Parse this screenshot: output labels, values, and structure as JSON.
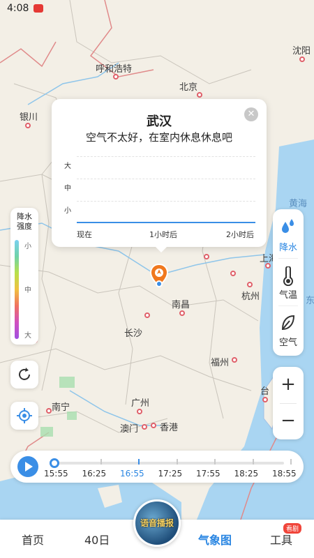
{
  "status": {
    "time": "4:08"
  },
  "map": {
    "cities": [
      {
        "name": "沈阳"
      },
      {
        "name": "呼和浩特"
      },
      {
        "name": "北京"
      },
      {
        "name": "银川"
      },
      {
        "name": "黄海"
      },
      {
        "name": "上海"
      },
      {
        "name": "杭州"
      },
      {
        "name": "南昌"
      },
      {
        "name": "长沙"
      },
      {
        "name": "福州"
      },
      {
        "name": "台"
      },
      {
        "name": "南宁"
      },
      {
        "name": "广州"
      },
      {
        "name": "澳门"
      },
      {
        "name": "香港"
      },
      {
        "name": "东"
      }
    ]
  },
  "popup": {
    "title": "武汉",
    "subtitle": "空气不太好，在室内休息休息吧",
    "levels": [
      "大",
      "中",
      "小"
    ],
    "times": [
      "现在",
      "1小时后",
      "2小时后"
    ]
  },
  "legend": {
    "title": "降水强度",
    "levels": [
      "小",
      "中",
      "大"
    ]
  },
  "layers": [
    {
      "label": "降水",
      "icon": "raindrop-icon"
    },
    {
      "label": "气温",
      "icon": "thermometer-icon"
    },
    {
      "label": "空气",
      "icon": "leaf-icon"
    }
  ],
  "zoom": {
    "in": "+",
    "out": "−"
  },
  "timeline": {
    "labels": [
      "15:55",
      "16:25",
      "16:55",
      "17:25",
      "17:55",
      "18:25",
      "18:55"
    ],
    "current_index": 0,
    "now_index": 2
  },
  "voice_broadcast": "语音播报",
  "nav": {
    "items": [
      "首页",
      "40日",
      "气象图",
      "工具"
    ],
    "badge": "看剧"
  },
  "colors": {
    "accent": "#3a8ee6",
    "marker": "#f0781e"
  }
}
